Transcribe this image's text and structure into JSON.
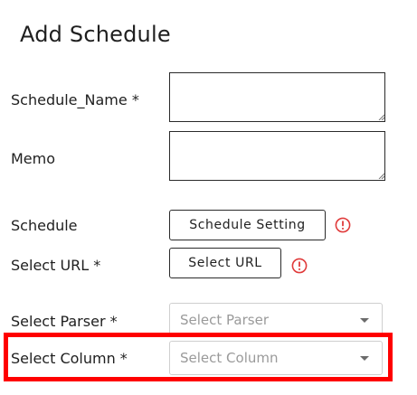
{
  "page": {
    "title": "Add Schedule"
  },
  "form": {
    "schedule_name_label": "Schedule_Name *",
    "schedule_name_value": "",
    "memo_label": "Memo",
    "memo_value": "",
    "schedule_label": "Schedule",
    "schedule_button_label": "Schedule Setting",
    "select_url_label": "Select URL *",
    "select_url_button_label": "Select URL",
    "select_parser_label": "Select Parser *",
    "select_parser_placeholder": "Select Parser",
    "select_column_label": "Select Column *",
    "select_column_placeholder": "Select Column"
  },
  "icons": {
    "alert": "exclamation-circle-icon",
    "dropdown": "chevron-down-icon",
    "resize": "resize-grip-icon"
  },
  "colors": {
    "alert": "#e03b3b",
    "highlight": "#ff0000",
    "placeholder": "#9a9a9a",
    "border": "#2a2a2a"
  }
}
